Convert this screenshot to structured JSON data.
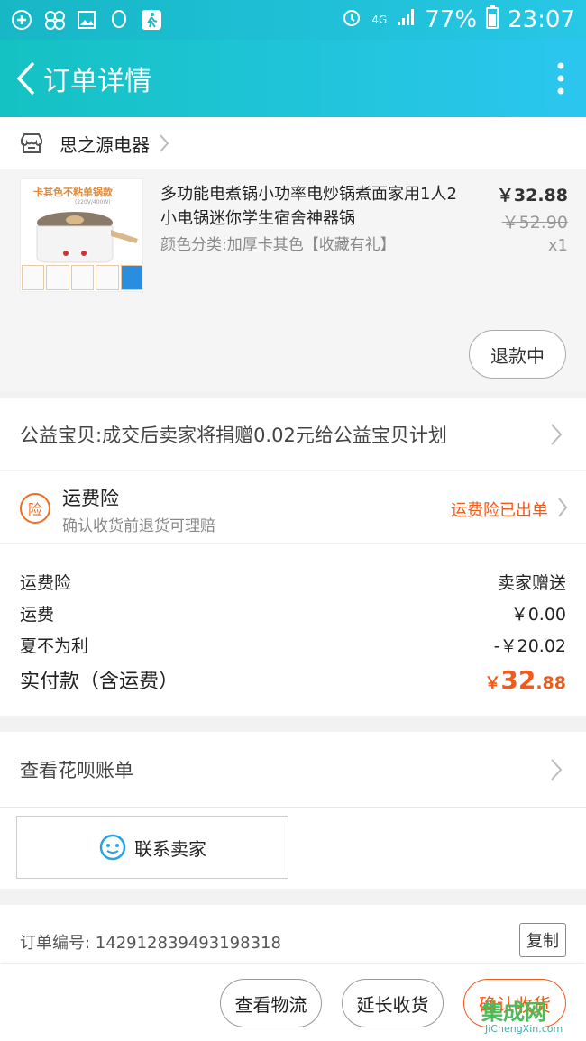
{
  "status_bar": {
    "icons": [
      "plus-circle-icon",
      "flower-icon",
      "image-icon",
      "qq-icon",
      "walk-icon"
    ],
    "right_icons": [
      "alarm-icon",
      "signal-icon"
    ],
    "network": "4G",
    "battery": "77%",
    "time": "23:07"
  },
  "header": {
    "title": "订单详情"
  },
  "shop": {
    "name": "思之源电器"
  },
  "product": {
    "image_label": "卡其色不粘单锅款",
    "image_sub": "(220V/400W)",
    "title": "多功能电煮锅小功率电炒锅煮面家用1人2小电锅迷你学生宿舍神器锅",
    "sku": "颜色分类:加厚卡其色【收藏有礼】",
    "price": "￥32.88",
    "original_price": "￥52.90",
    "quantity": "x1",
    "refund_label": "退款中"
  },
  "charity": {
    "text": "公益宝贝:成交后卖家将捐赠0.02元给公益宝贝计划"
  },
  "insurance": {
    "badge": "险",
    "name": "运费险",
    "desc": "确认收货前退货可理赔",
    "status": "运费险已出单"
  },
  "fees": {
    "rows": [
      {
        "label": "运费险",
        "value": "卖家赠送"
      },
      {
        "label": "运费",
        "value": "￥0.00"
      },
      {
        "label": "夏不为利",
        "value": "-￥20.02"
      }
    ],
    "total_label": "实付款（含运费）",
    "total_currency": "￥",
    "total_int": "32",
    "total_dec": ".88"
  },
  "huabei": {
    "text": "查看花呗账单"
  },
  "contact": {
    "label": "联系卖家"
  },
  "order": {
    "number": "订单编号: 142912839493198318",
    "copy_label": "复制"
  },
  "bottom": {
    "logistics": "查看物流",
    "extend": "延长收货",
    "confirm": "确认收货"
  },
  "watermark": {
    "text": "集成网",
    "domain": "JiChengXin.com"
  },
  "colors": {
    "accent": "#f05a1a",
    "header": "#1fc3d8"
  }
}
